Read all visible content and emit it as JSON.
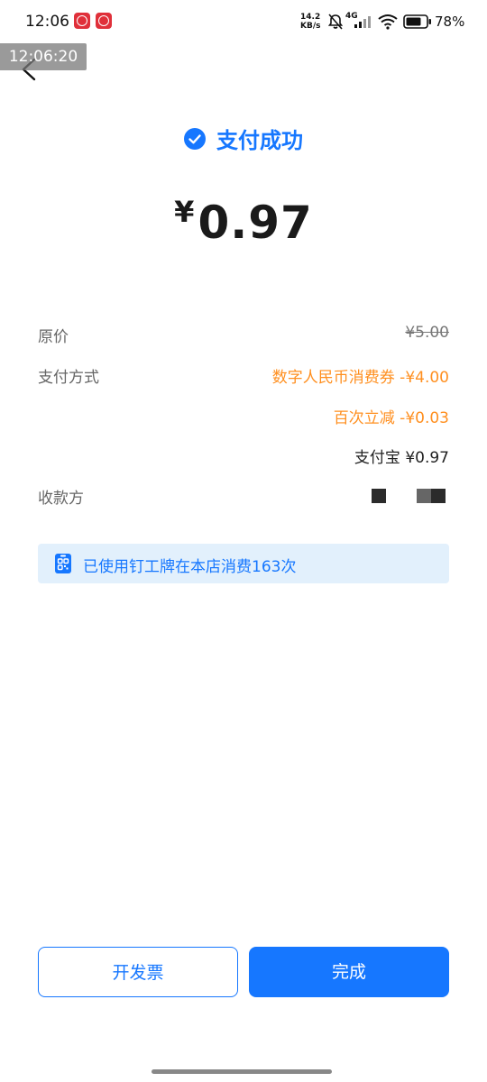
{
  "status_bar": {
    "time": "12:06",
    "net_speed_value": "14.2",
    "net_speed_unit": "KB/s",
    "network_type": "4G",
    "battery": "78%",
    "icons": [
      "bank-app-icon",
      "bank-app-icon-2",
      "mute-bell-icon",
      "signal-icon",
      "wifi-icon",
      "battery-icon"
    ]
  },
  "overlay_timestamp": "12:06:20",
  "header": {
    "success_text": "支付成功",
    "currency_symbol": "¥",
    "amount": "0.97"
  },
  "details": {
    "original_price_label": "原价",
    "original_price_value": "¥5.00",
    "payment_method_label": "支付方式",
    "payment_lines": [
      "数字人民币消费券 -¥4.00",
      "百次立减 -¥0.03",
      "支付宝 ¥0.97"
    ],
    "payee_label": "收款方"
  },
  "badge": {
    "text": "已使用钉工牌在本店消费163次",
    "icon": "badge-card-icon"
  },
  "buttons": {
    "invoice": "开发票",
    "done": "完成"
  },
  "colors": {
    "accent": "#1677ff",
    "discount": "#ff8f1f",
    "badge_bg": "#e2f0fc"
  }
}
